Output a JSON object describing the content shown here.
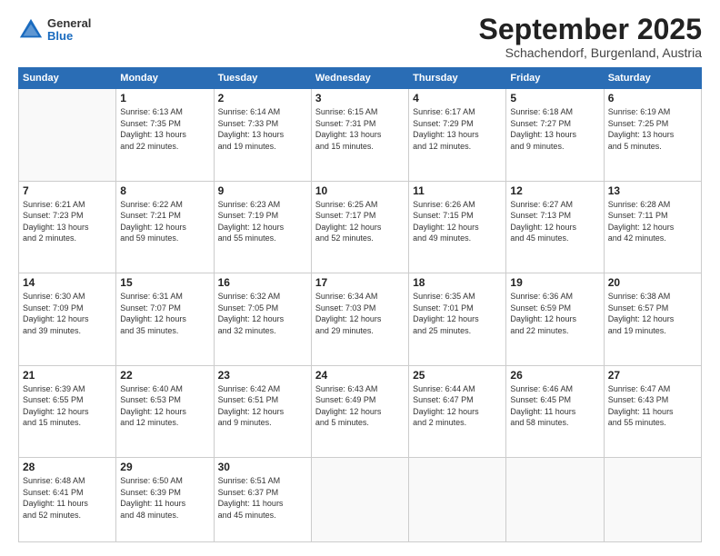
{
  "header": {
    "logo": {
      "general": "General",
      "blue": "Blue"
    },
    "title": "September 2025",
    "location": "Schachendorf, Burgenland, Austria"
  },
  "weekdays": [
    "Sunday",
    "Monday",
    "Tuesday",
    "Wednesday",
    "Thursday",
    "Friday",
    "Saturday"
  ],
  "weeks": [
    [
      {
        "day": "",
        "info": ""
      },
      {
        "day": "1",
        "info": "Sunrise: 6:13 AM\nSunset: 7:35 PM\nDaylight: 13 hours\nand 22 minutes."
      },
      {
        "day": "2",
        "info": "Sunrise: 6:14 AM\nSunset: 7:33 PM\nDaylight: 13 hours\nand 19 minutes."
      },
      {
        "day": "3",
        "info": "Sunrise: 6:15 AM\nSunset: 7:31 PM\nDaylight: 13 hours\nand 15 minutes."
      },
      {
        "day": "4",
        "info": "Sunrise: 6:17 AM\nSunset: 7:29 PM\nDaylight: 13 hours\nand 12 minutes."
      },
      {
        "day": "5",
        "info": "Sunrise: 6:18 AM\nSunset: 7:27 PM\nDaylight: 13 hours\nand 9 minutes."
      },
      {
        "day": "6",
        "info": "Sunrise: 6:19 AM\nSunset: 7:25 PM\nDaylight: 13 hours\nand 5 minutes."
      }
    ],
    [
      {
        "day": "7",
        "info": "Sunrise: 6:21 AM\nSunset: 7:23 PM\nDaylight: 13 hours\nand 2 minutes."
      },
      {
        "day": "8",
        "info": "Sunrise: 6:22 AM\nSunset: 7:21 PM\nDaylight: 12 hours\nand 59 minutes."
      },
      {
        "day": "9",
        "info": "Sunrise: 6:23 AM\nSunset: 7:19 PM\nDaylight: 12 hours\nand 55 minutes."
      },
      {
        "day": "10",
        "info": "Sunrise: 6:25 AM\nSunset: 7:17 PM\nDaylight: 12 hours\nand 52 minutes."
      },
      {
        "day": "11",
        "info": "Sunrise: 6:26 AM\nSunset: 7:15 PM\nDaylight: 12 hours\nand 49 minutes."
      },
      {
        "day": "12",
        "info": "Sunrise: 6:27 AM\nSunset: 7:13 PM\nDaylight: 12 hours\nand 45 minutes."
      },
      {
        "day": "13",
        "info": "Sunrise: 6:28 AM\nSunset: 7:11 PM\nDaylight: 12 hours\nand 42 minutes."
      }
    ],
    [
      {
        "day": "14",
        "info": "Sunrise: 6:30 AM\nSunset: 7:09 PM\nDaylight: 12 hours\nand 39 minutes."
      },
      {
        "day": "15",
        "info": "Sunrise: 6:31 AM\nSunset: 7:07 PM\nDaylight: 12 hours\nand 35 minutes."
      },
      {
        "day": "16",
        "info": "Sunrise: 6:32 AM\nSunset: 7:05 PM\nDaylight: 12 hours\nand 32 minutes."
      },
      {
        "day": "17",
        "info": "Sunrise: 6:34 AM\nSunset: 7:03 PM\nDaylight: 12 hours\nand 29 minutes."
      },
      {
        "day": "18",
        "info": "Sunrise: 6:35 AM\nSunset: 7:01 PM\nDaylight: 12 hours\nand 25 minutes."
      },
      {
        "day": "19",
        "info": "Sunrise: 6:36 AM\nSunset: 6:59 PM\nDaylight: 12 hours\nand 22 minutes."
      },
      {
        "day": "20",
        "info": "Sunrise: 6:38 AM\nSunset: 6:57 PM\nDaylight: 12 hours\nand 19 minutes."
      }
    ],
    [
      {
        "day": "21",
        "info": "Sunrise: 6:39 AM\nSunset: 6:55 PM\nDaylight: 12 hours\nand 15 minutes."
      },
      {
        "day": "22",
        "info": "Sunrise: 6:40 AM\nSunset: 6:53 PM\nDaylight: 12 hours\nand 12 minutes."
      },
      {
        "day": "23",
        "info": "Sunrise: 6:42 AM\nSunset: 6:51 PM\nDaylight: 12 hours\nand 9 minutes."
      },
      {
        "day": "24",
        "info": "Sunrise: 6:43 AM\nSunset: 6:49 PM\nDaylight: 12 hours\nand 5 minutes."
      },
      {
        "day": "25",
        "info": "Sunrise: 6:44 AM\nSunset: 6:47 PM\nDaylight: 12 hours\nand 2 minutes."
      },
      {
        "day": "26",
        "info": "Sunrise: 6:46 AM\nSunset: 6:45 PM\nDaylight: 11 hours\nand 58 minutes."
      },
      {
        "day": "27",
        "info": "Sunrise: 6:47 AM\nSunset: 6:43 PM\nDaylight: 11 hours\nand 55 minutes."
      }
    ],
    [
      {
        "day": "28",
        "info": "Sunrise: 6:48 AM\nSunset: 6:41 PM\nDaylight: 11 hours\nand 52 minutes."
      },
      {
        "day": "29",
        "info": "Sunrise: 6:50 AM\nSunset: 6:39 PM\nDaylight: 11 hours\nand 48 minutes."
      },
      {
        "day": "30",
        "info": "Sunrise: 6:51 AM\nSunset: 6:37 PM\nDaylight: 11 hours\nand 45 minutes."
      },
      {
        "day": "",
        "info": ""
      },
      {
        "day": "",
        "info": ""
      },
      {
        "day": "",
        "info": ""
      },
      {
        "day": "",
        "info": ""
      }
    ]
  ]
}
